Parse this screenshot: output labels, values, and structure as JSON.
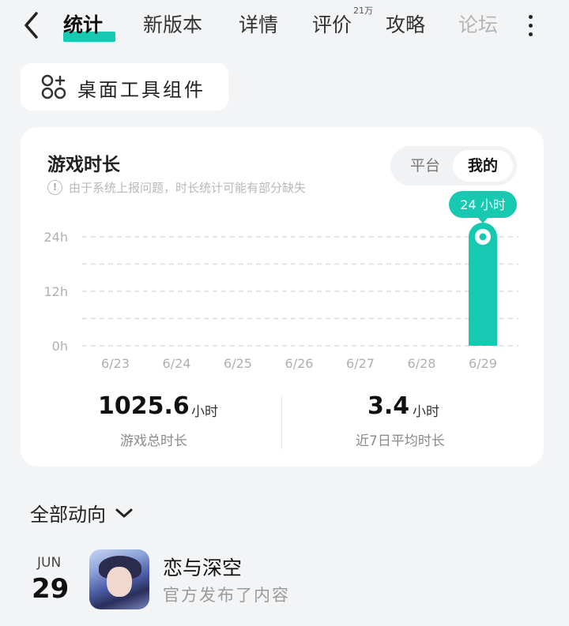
{
  "tabs": [
    {
      "label": "统计",
      "active": true
    },
    {
      "label": "新版本"
    },
    {
      "label": "详情"
    },
    {
      "label": "评价",
      "badge": "21万"
    },
    {
      "label": "攻略"
    },
    {
      "label": "论坛"
    }
  ],
  "widget_button": {
    "label": "桌面工具组件"
  },
  "card": {
    "title": "游戏时长",
    "note": "由于系统上报问题，时长统计可能有部分缺失",
    "toggle": {
      "platform": "平台",
      "mine": "我的"
    }
  },
  "chart_data": {
    "type": "bar",
    "categories": [
      "6/23",
      "6/24",
      "6/25",
      "6/26",
      "6/27",
      "6/28",
      "6/29"
    ],
    "values": [
      0,
      0,
      0,
      0,
      0,
      0,
      24
    ],
    "y_ticks": [
      "0h",
      "12h",
      "24h"
    ],
    "ylim": [
      0,
      24
    ],
    "grid": true,
    "highlight": {
      "index": 6,
      "label": "24 小时"
    },
    "bar_color": "#18c9b2"
  },
  "stats": [
    {
      "value": "1025.6",
      "unit": "小时",
      "label": "游戏总时长"
    },
    {
      "value": "3.4",
      "unit": "小时",
      "label": "近7日平均时长"
    }
  ],
  "section": {
    "label": "全部动向"
  },
  "feed": [
    {
      "month": "JUN",
      "day": "29",
      "title": "恋与深空",
      "subtitle": "官方发布了内容"
    }
  ],
  "accent_color": "#18c9b2"
}
